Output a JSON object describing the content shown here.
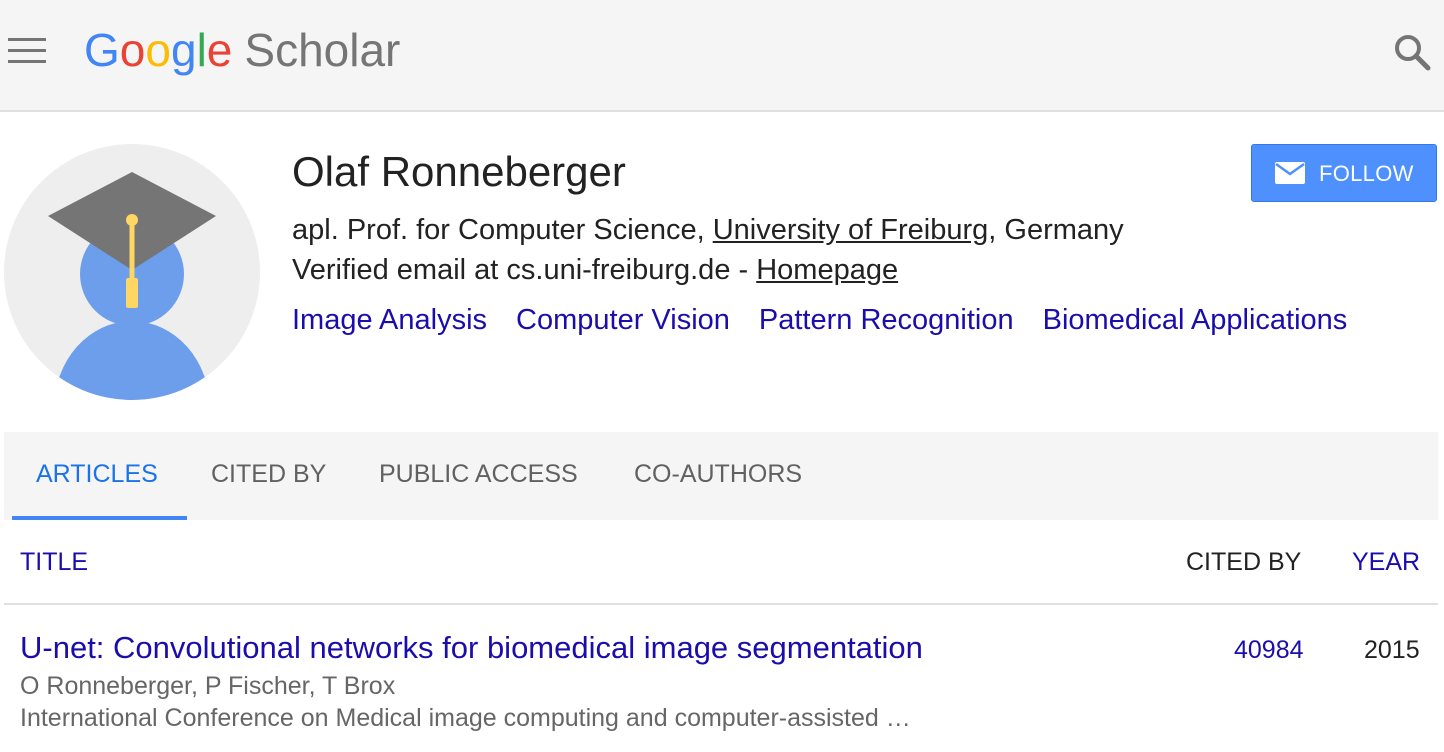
{
  "header": {
    "logo_google": "Google",
    "logo_scholar": "Scholar",
    "menu_icon": "menu-icon",
    "search_icon": "search-icon"
  },
  "profile": {
    "name": "Olaf Ronneberger",
    "affiliation_prefix": "apl. Prof. for Computer Science, ",
    "affiliation_link": "University of Freiburg",
    "affiliation_suffix": ", Germany",
    "verified_prefix": "Verified email at cs.uni-freiburg.de - ",
    "homepage_link": "Homepage",
    "interests": [
      "Image Analysis",
      "Computer Vision",
      "Pattern Recognition",
      "Biomedical Applications"
    ],
    "follow_label": "FOLLOW",
    "avatar_icon": "graduate-avatar-icon"
  },
  "tabs": [
    {
      "label": "ARTICLES",
      "active": true
    },
    {
      "label": "CITED BY",
      "active": false
    },
    {
      "label": "PUBLIC ACCESS",
      "active": false
    },
    {
      "label": "CO-AUTHORS",
      "active": false
    }
  ],
  "table": {
    "headers": {
      "title": "TITLE",
      "cited_by": "CITED BY",
      "year": "YEAR"
    },
    "rows": [
      {
        "title": "U-net: Convolutional networks for biomedical image segmentation",
        "authors": "O Ronneberger, P Fischer, T Brox",
        "venue": "International Conference on Medical image computing and computer-assisted …",
        "cited_by": "40984",
        "year": "2015"
      }
    ]
  },
  "colors": {
    "link": "#1a0dab",
    "accent": "#4285f4",
    "follow_button": "#4d90fe"
  }
}
